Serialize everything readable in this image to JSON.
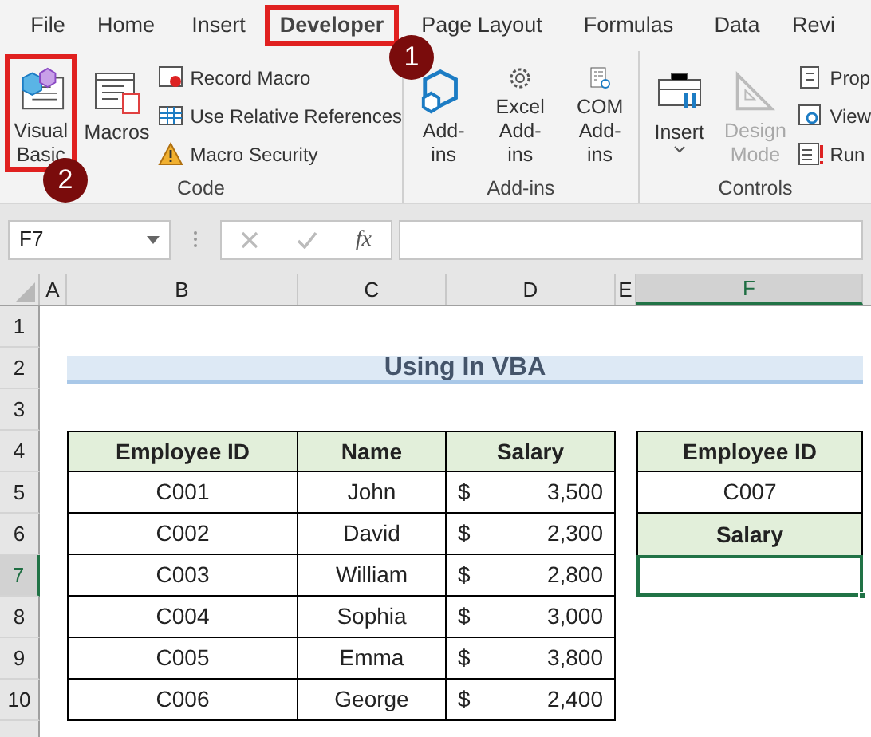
{
  "ribbon_tabs": [
    {
      "label": "File",
      "selected": false,
      "highlighted": false
    },
    {
      "label": "Home",
      "selected": false,
      "highlighted": false
    },
    {
      "label": "Insert",
      "selected": false,
      "highlighted": false
    },
    {
      "label": "Developer",
      "selected": true,
      "highlighted": true
    },
    {
      "label": "Page Layout",
      "selected": false,
      "highlighted": false
    },
    {
      "label": "Formulas",
      "selected": false,
      "highlighted": false
    },
    {
      "label": "Data",
      "selected": false,
      "highlighted": false
    },
    {
      "label": "Revi",
      "selected": false,
      "highlighted": false
    }
  ],
  "ribbon_groups": [
    {
      "label": "Code",
      "buttons": [
        {
          "kind": "large",
          "label": "Visual Basic",
          "disabled": false,
          "highlighted": true
        },
        {
          "kind": "large",
          "label": "Macros",
          "disabled": false,
          "highlighted": false
        },
        {
          "kind": "small",
          "label": "Record Macro",
          "disabled": false
        },
        {
          "kind": "small",
          "label": "Use Relative References",
          "disabled": false
        },
        {
          "kind": "small",
          "label": "Macro Security",
          "disabled": false
        }
      ]
    },
    {
      "label": "Add-ins",
      "buttons": [
        {
          "kind": "large",
          "label": "Add-ins",
          "disabled": false,
          "highlighted": false
        },
        {
          "kind": "large",
          "label": "Excel Add-ins",
          "disabled": false,
          "highlighted": false
        },
        {
          "kind": "large",
          "label": "COM Add-ins",
          "disabled": false,
          "highlighted": false
        }
      ]
    },
    {
      "label": "Controls",
      "buttons": [
        {
          "kind": "dropdown",
          "label": "Insert",
          "disabled": false,
          "highlighted": false
        },
        {
          "kind": "large",
          "label": "Design Mode",
          "disabled": true,
          "highlighted": false
        },
        {
          "kind": "small",
          "label": "Prop",
          "disabled": false
        },
        {
          "kind": "small",
          "label": "View",
          "disabled": false
        },
        {
          "kind": "small",
          "label": "Run",
          "disabled": false
        }
      ]
    }
  ],
  "step_badges": [
    {
      "label": "1"
    },
    {
      "label": "2"
    }
  ],
  "formula_bar": {
    "name_box": "F7",
    "function_label": "fx"
  },
  "columns": [
    {
      "label": "A",
      "selected": false
    },
    {
      "label": "B",
      "selected": false
    },
    {
      "label": "C",
      "selected": false
    },
    {
      "label": "D",
      "selected": false
    },
    {
      "label": "E",
      "selected": false
    },
    {
      "label": "F",
      "selected": true
    }
  ],
  "rows": [
    {
      "label": "1",
      "selected": false
    },
    {
      "label": "2",
      "selected": false
    },
    {
      "label": "3",
      "selected": false
    },
    {
      "label": "4",
      "selected": false
    },
    {
      "label": "5",
      "selected": false
    },
    {
      "label": "6",
      "selected": false
    },
    {
      "label": "7",
      "selected": true
    },
    {
      "label": "8",
      "selected": false
    },
    {
      "label": "9",
      "selected": false
    },
    {
      "label": "10",
      "selected": false
    }
  ],
  "title": "Using In VBA",
  "table": {
    "columns": [
      "Employee ID",
      "Name",
      "Salary"
    ],
    "rows": [
      {
        "id": "C001",
        "name": "John",
        "currency": "$",
        "salary": "3,500"
      },
      {
        "id": "C002",
        "name": "David",
        "currency": "$",
        "salary": "2,300"
      },
      {
        "id": "C003",
        "name": "William",
        "currency": "$",
        "salary": "2,800"
      },
      {
        "id": "C004",
        "name": "Sophia",
        "currency": "$",
        "salary": "3,000"
      },
      {
        "id": "C005",
        "name": "Emma",
        "currency": "$",
        "salary": "3,800"
      },
      {
        "id": "C006",
        "name": "George",
        "currency": "$",
        "salary": "2,400"
      }
    ]
  },
  "lookup": {
    "header": "Employee ID",
    "value": "C007",
    "result_header": "Salary"
  }
}
